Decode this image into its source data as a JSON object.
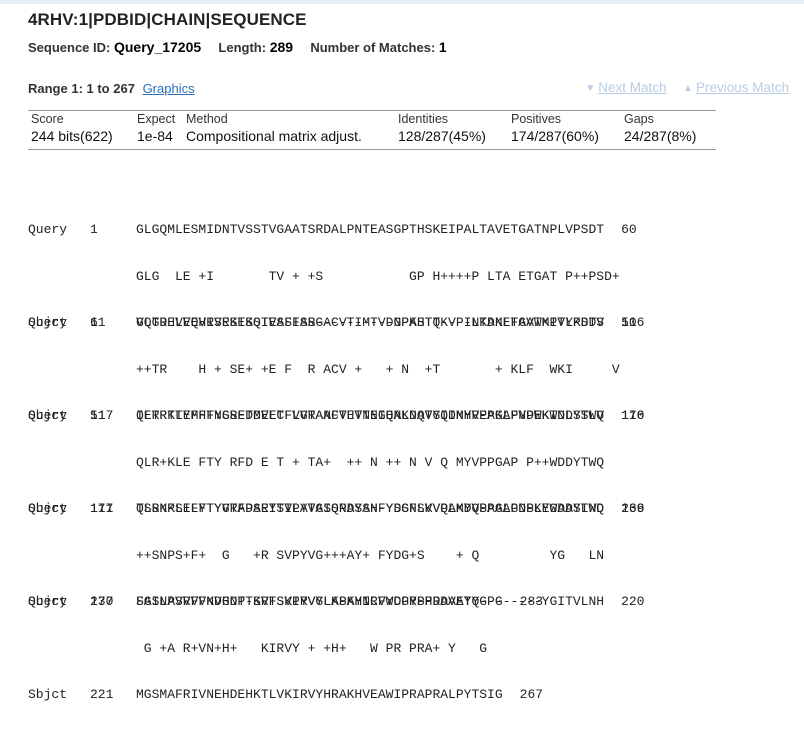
{
  "header": {
    "title": "4RHV:1|PDBID|CHAIN|SEQUENCE",
    "sequence_id_label": "Sequence ID:",
    "sequence_id": "Query_17205",
    "length_label": "Length:",
    "length": "289",
    "matches_label": "Number of Matches:",
    "matches": "1"
  },
  "range": {
    "label": "Range 1: 1 to 267",
    "graphics_link": "Graphics",
    "next_match": "Next Match",
    "previous_match": "Previous Match"
  },
  "stats": {
    "score_header": "Score",
    "score": "244 bits(622)",
    "expect_header": "Expect",
    "expect": "1e-84",
    "method_header": "Method",
    "method": "Compositional matrix adjust.",
    "identities_header": "Identities",
    "identities": "128/287(45%)",
    "positives_header": "Positives",
    "positives": "174/287(60%)",
    "gaps_header": "Gaps",
    "gaps": "24/287(8%)"
  },
  "alignment": [
    {
      "query_label": "Query",
      "query_start": "1",
      "query_seq": "GLGQMLESMIDNTVSSTVGAATSRDALPNTEASGPTHSKEIPALTAVETGATNPLVPSDT",
      "query_end": "60",
      "midline": "GLG  LE +I       TV + +S           GP H++++P LTA ETGAT P++PSD+",
      "sbjct_label": "Sbjct",
      "sbjct_start": "1",
      "sbjct_seq": "GLGDELEEVIVEKTKQTVASISS----------GPKHTQKVPILTANETGATMPVLPSDS",
      "sbjct_end": "50"
    },
    {
      "query_label": "Query",
      "query_start": "61",
      "query_seq": "VQTRHVVQHRSRSESSIESFFARGACVTIMTVDNPASTT----NKDKLFAVWKITYKDTV",
      "query_end": "116",
      "midline": "++TR    H + SE+ +E F  R ACV +   + N  +T       + KLF  WKI     V",
      "sbjct_label": "Sbjct",
      "sbjct_start": "51",
      "sbjct_seq": "IETRTTYMHFNGSETDVECFLGRAACVHVTEIQNKDATGIDNHREAKLFNDWKINLSSLV",
      "sbjct_end": "110"
    },
    {
      "query_label": "Query",
      "query_start": "117",
      "query_seq": "QLRRKLEFFTYSRFDMELTFVVTANFTETNNGHALNQVYQIMYVPPGAPVPEKWDDYTWQ",
      "query_end": "176",
      "midline": "QLR+KLE FTY RFD E T + TA+  ++ N ++ N V Q MYVPPGAP P++WDDYTWQ",
      "sbjct_label": "Sbjct",
      "sbjct_start": "111",
      "sbjct_seq": "QLRKKLELFTYVRFDSEYTILATASQPDSAN-YSSNLVVQAMYVPPGAPNPKEWDDYTWQ",
      "sbjct_end": "169"
    },
    {
      "query_label": "Query",
      "query_start": "177",
      "query_seq": "TSSNPSIFYTYGTAPARISVPYVGISNAYSHFYDGFSKVPLKDQSAALGDSLYGAASLND",
      "query_end": "236",
      "midline": "++SNPS+F+  G   +R SVPYVG+++AY+ FYDG+S    + Q         YG   LN",
      "sbjct_label": "Sbjct",
      "sbjct_start": "170",
      "sbjct_seq": "SASNPSVFFKVGDT-SRFSVPYVGLASAYNCFYDGYSHDDAETQ--------YGITVLNH",
      "sbjct_end": "220"
    },
    {
      "query_label": "Query",
      "query_start": "237",
      "query_seq": "FGILAVRVVNDHNPTKVTSKIRVYLKPKHIRVWCPRPPRAVAYYGPG",
      "query_end": "283",
      "midline": " G +A R+VN+H+   KIRVY + +H+   W PR PRA+ Y   G",
      "sbjct_label": "Sbjct",
      "sbjct_start": "221",
      "sbjct_seq": "MGSMAFRIVNEHDEHKTLVKIRVYHRAKHVEAWIPRAPRALPYTSIG",
      "sbjct_end": "267"
    }
  ]
}
